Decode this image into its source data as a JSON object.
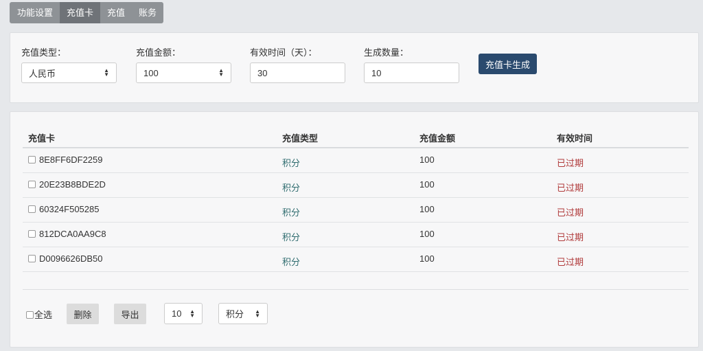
{
  "tabs": [
    {
      "label": "功能设置"
    },
    {
      "label": "充值卡"
    },
    {
      "label": "充值"
    },
    {
      "label": "账务"
    }
  ],
  "form": {
    "type_label": "充值类型：",
    "type_value": "人民币",
    "amount_label": "充值金额：",
    "amount_value": "100",
    "valid_label": "有效时间（天）：",
    "valid_value": "30",
    "count_label": "生成数量：",
    "count_value": "10",
    "generate_button": "充值卡生成"
  },
  "table": {
    "headers": [
      "充值卡",
      "充值类型",
      "充值金额",
      "有效时间"
    ],
    "rows": [
      {
        "card": "8E8FF6DF2259",
        "type": "积分",
        "amount": "100",
        "status": "已过期"
      },
      {
        "card": "20E23B8BDE2D",
        "type": "积分",
        "amount": "100",
        "status": "已过期"
      },
      {
        "card": "60324F505285",
        "type": "积分",
        "amount": "100",
        "status": "已过期"
      },
      {
        "card": "812DCA0AA9C8",
        "type": "积分",
        "amount": "100",
        "status": "已过期"
      },
      {
        "card": "D0096626DB50",
        "type": "积分",
        "amount": "100",
        "status": "已过期"
      }
    ]
  },
  "footer": {
    "select_all": "全选",
    "delete_button": "删除",
    "export_button": "导出",
    "page_size": "10",
    "export_type": "积分"
  },
  "colors": {
    "primary_button": "#2a4a6e",
    "active_tab": "#6f7378",
    "type_text": "#2e6b6e",
    "expired_text": "#b03a3a"
  }
}
